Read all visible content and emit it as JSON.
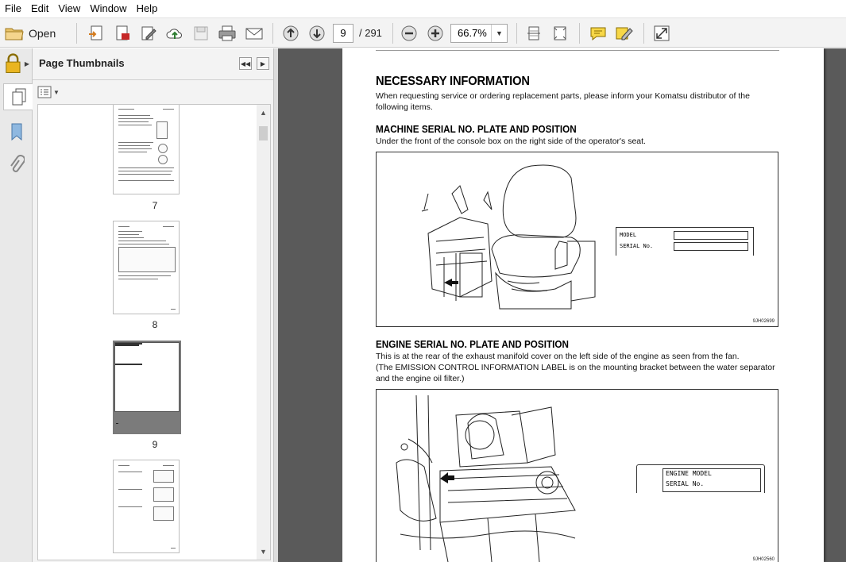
{
  "menu": [
    "File",
    "Edit",
    "View",
    "Window",
    "Help"
  ],
  "toolbar": {
    "open_label": "Open",
    "page_current": "9",
    "page_total": "/ 291",
    "zoom": "66.7%"
  },
  "panel": {
    "title": "Page Thumbnails",
    "thumbnails": [
      "7",
      "8",
      "9"
    ]
  },
  "document": {
    "heading": "NECESSARY INFORMATION",
    "intro": "When requesting service or ordering replacement parts, please inform your Komatsu distributor of the following items.",
    "section1": {
      "title": "MACHINE SERIAL NO. PLATE AND POSITION",
      "text": "Under the front of the console box on the right side of the operator's seat.",
      "plate_model": "MODEL",
      "plate_serial": "SERIAL No.",
      "fig_code": "9JH02699"
    },
    "section2": {
      "title": "ENGINE SERIAL NO. PLATE AND POSITION",
      "text1": "This is at the rear of the exhaust manifold cover on the left side of the engine as seen from the fan.",
      "text2": "(The EMISSION CONTROL INFORMATION LABEL is on the mounting bracket between the water separator and the engine oil filter.)",
      "plate_model": "ENGINE MODEL",
      "plate_serial": "SERIAL No.",
      "fig_code": "9JH02560"
    }
  }
}
